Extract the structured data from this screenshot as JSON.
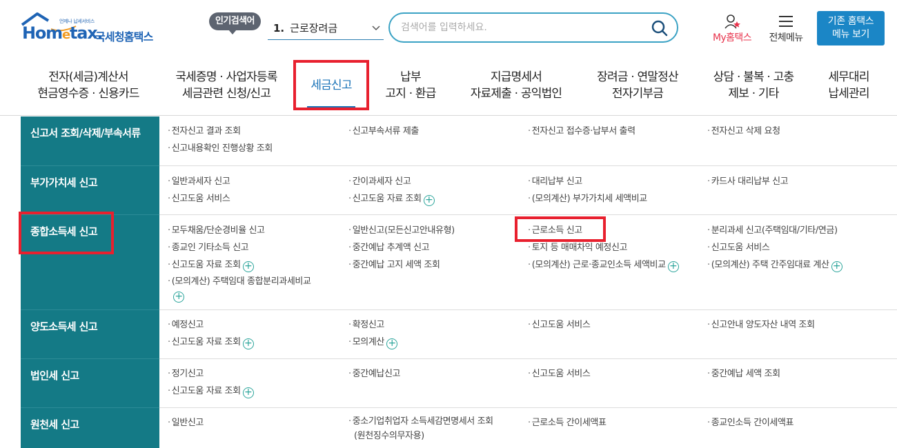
{
  "header": {
    "logo_tagline": "언제나 납세서비스",
    "logo_home": "Hom",
    "logo_e": "e",
    "logo_tax": "tax.",
    "logo_korean": "국세청홈택스",
    "popular_badge": "인기검색어",
    "popular_rank": "1.",
    "popular_term": "근로장려금",
    "search_placeholder": "검색어를 입력하세요.",
    "my_hometax_prefix": "My",
    "my_hometax_suffix": "홈택스",
    "all_menu": "전체메뉴",
    "old_home_line1": "기존 홈택스",
    "old_home_line2": "메뉴 보기"
  },
  "gnb": [
    {
      "line1": "전자(세금)계산서",
      "line2": "현금영수증 · 신용카드"
    },
    {
      "line1": "국세증명 · 사업자등록",
      "line2": "세금관련 신청/신고"
    },
    {
      "line1": "세금신고",
      "line2": ""
    },
    {
      "line1": "납부",
      "line2": "고지 · 환급"
    },
    {
      "line1": "지급명세서",
      "line2": "자료제출 · 공익법인"
    },
    {
      "line1": "장려금 · 연말정산",
      "line2": "전자기부금"
    },
    {
      "line1": "상담 · 불복 · 고충",
      "line2": "제보 · 기타"
    },
    {
      "line1": "세무대리",
      "line2": "납세관리"
    }
  ],
  "sections": [
    {
      "title": "신고서 조회/삭제/부속서류",
      "cols": [
        [
          "전자신고 결과 조회",
          "신고내용확인 진행상황 조회"
        ],
        [
          "신고부속서류 제출"
        ],
        [
          "전자신고 접수증·납부서 출력"
        ],
        [
          "전자신고 삭제 요청"
        ]
      ]
    },
    {
      "title": "부가가치세 신고",
      "cols": [
        [
          "일반과세자 신고",
          "신고도움 서비스"
        ],
        [
          "간이과세자 신고",
          "신고도움 자료 조회"
        ],
        [
          "대리납부 신고",
          "(모의계산) 부가가치세 세액비교"
        ],
        [
          "카드사 대리납부 신고"
        ]
      ]
    },
    {
      "title": "종합소득세 신고",
      "cols": [
        [
          "모두채움/단순경비율 신고",
          "종교인 기타소득 신고",
          "신고도움 자료 조회",
          "(모의계산) 주택임대 종합분리과세비교"
        ],
        [
          "일반신고(모든신고안내유형)",
          "중간예납 추계액 신고",
          "중간예납 고지 세액 조회"
        ],
        [
          "근로소득 신고",
          "토지 등 매매차익 예정신고",
          "(모의계산) 근로·종교인소득 세액비교"
        ],
        [
          "분리과세 신고(주택임대/기타/연금)",
          "신고도움 서비스",
          "(모의계산) 주택 간주임대료 계산"
        ]
      ]
    },
    {
      "title": "양도소득세 신고",
      "cols": [
        [
          "예정신고",
          "신고도움 자료 조회"
        ],
        [
          "확정신고",
          "모의계산"
        ],
        [
          "신고도움 서비스"
        ],
        [
          "신고안내 양도자산 내역 조회"
        ]
      ]
    },
    {
      "title": "법인세 신고",
      "cols": [
        [
          "정기신고",
          "신고도움 자료 조회"
        ],
        [
          "중간예납신고"
        ],
        [
          "신고도움 서비스"
        ],
        [
          "중간예납 세액 조회"
        ]
      ]
    },
    {
      "title": "원천세 신고",
      "cols": [
        [
          "일반신고"
        ],
        [
          "중소기업취업자 소득세감면명세서 조회",
          "(원천징수의무자용)"
        ],
        [
          "근로소득 간이세액표"
        ],
        [
          "종교인소득 간이세액표"
        ]
      ]
    }
  ],
  "plus_symbol": "+",
  "colors": {
    "brand_blue": "#1f64b5",
    "accent_orange": "#f39a1f",
    "section_teal": "#147a86",
    "highlight_red": "#e8202e",
    "button_blue": "#1b86c6"
  }
}
